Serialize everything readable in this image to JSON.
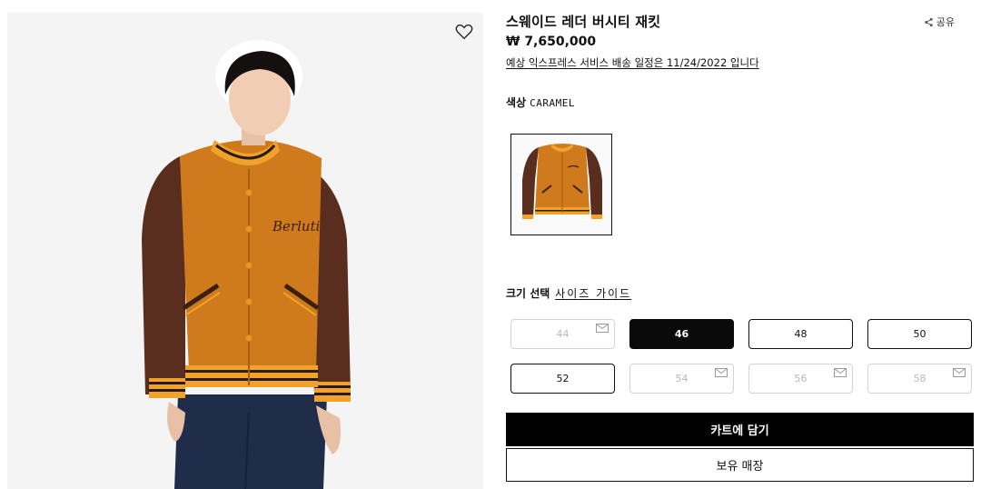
{
  "product": {
    "title": "스웨이드 레더 버시티 재킷",
    "price": "₩ 7,650,000",
    "delivery_notice": "예상 익스프레스 서비스 배송 일정은 11/24/2022 입니다",
    "share_label": "공유",
    "image_brand_embroidery": "Berluti"
  },
  "color": {
    "label": "색상",
    "value": "CARAMEL"
  },
  "size": {
    "label": "크기 선택",
    "guide_label": "사이즈 가이드",
    "options": [
      {
        "label": "44",
        "available": false,
        "selected": false
      },
      {
        "label": "46",
        "available": true,
        "selected": true
      },
      {
        "label": "48",
        "available": true,
        "selected": false
      },
      {
        "label": "50",
        "available": true,
        "selected": false
      },
      {
        "label": "52",
        "available": true,
        "selected": false
      },
      {
        "label": "54",
        "available": false,
        "selected": false
      },
      {
        "label": "56",
        "available": false,
        "selected": false
      },
      {
        "label": "58",
        "available": false,
        "selected": false
      }
    ]
  },
  "actions": {
    "add_to_cart": "카트에 담기",
    "store_stock": "보유 매장"
  },
  "icons": {
    "wishlist": "heart-icon",
    "share": "share-icon",
    "notify": "mail-icon"
  },
  "colors": {
    "primary": "#000000",
    "disabled_border": "#d4d4d4",
    "disabled_text": "#b8b8b8",
    "image_bg": "#f4f4f4"
  }
}
